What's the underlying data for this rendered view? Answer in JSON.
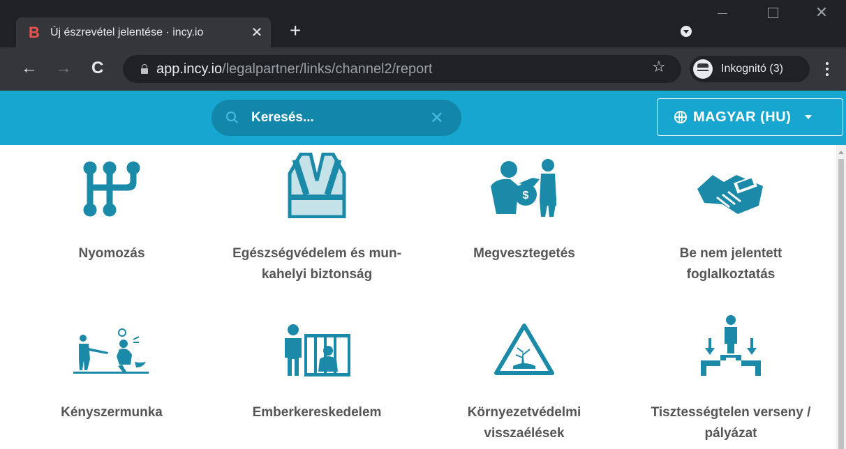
{
  "browser": {
    "tab_title": "Új észrevétel jelentése · incy.io",
    "url_host": "app.incy.io",
    "url_path": "/legalpartner/links/channel2/report",
    "incognito_label": "Inkognitó (3)"
  },
  "appbar": {
    "search_placeholder": "Keresés...",
    "language_label": "MAGYAR (HU)"
  },
  "categories": [
    {
      "label": "Nyomozás",
      "icon": "gear-shift-icon"
    },
    {
      "label": "Egészségvédelem és mun-kahelyi biztonság",
      "line1": "Egészségvédelem és mun-",
      "line2": "kahelyi biztonság",
      "icon": "safety-vest-icon"
    },
    {
      "label": "Megvesztegetés",
      "icon": "bribery-icon"
    },
    {
      "label": "Be nem jelentett foglalkoztatás",
      "line1": "Be nem jelentett",
      "line2": "foglalkoztatás",
      "icon": "handshake-money-icon"
    },
    {
      "label": "Kényszermunka",
      "icon": "forced-labor-icon"
    },
    {
      "label": "Emberkereskedelem",
      "icon": "human-trafficking-icon"
    },
    {
      "label": "Környezetvédelmi visszaélések",
      "line1": "Környezetvédelmi",
      "line2": "visszaélések",
      "icon": "environment-warning-icon"
    },
    {
      "label": "Tisztességtelen verseny / pályázat",
      "line1": "Tisztességtelen verseny /",
      "line2": "pályázat",
      "icon": "podium-icon"
    }
  ],
  "colors": {
    "accent": "#16a6cf",
    "icon": "#1a8aa8",
    "search_bg": "#1387aa"
  }
}
